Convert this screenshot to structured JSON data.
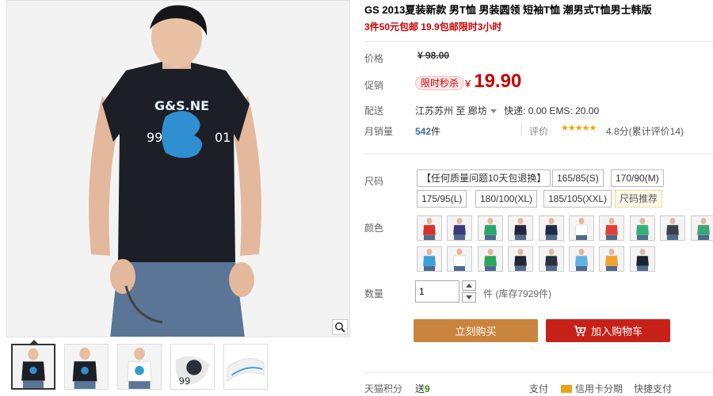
{
  "product": {
    "title": "GS 2013夏装新款 男T恤 男装圆领 短袖T恤 潮男式T恤男士韩版",
    "subtitle": "3件50元包邮 19.9包邮限时3小时"
  },
  "price": {
    "label": "价格",
    "original": "¥ 98.00"
  },
  "promo": {
    "label": "促销",
    "tag": "限时秒杀",
    "currency": "¥",
    "value": "19.90"
  },
  "shipping": {
    "label": "配送",
    "from": "江苏苏州",
    "to_word": "至",
    "dest": "廊坊",
    "fees": "快递: 0.00 EMS: 20.00"
  },
  "sales": {
    "label": "月销量",
    "count": "542",
    "unit": "件",
    "rating_label": "评价",
    "stars": "★★★★★",
    "rating_text": "4.8分(累计评价14)"
  },
  "sizes": {
    "label": "尺码",
    "options": [
      "【任何质量问题10天包退换】",
      "165/85(S)",
      "170/90(M)",
      "175/95(L)",
      "180/100(XL)",
      "185/105(XXL)"
    ],
    "hint": "尺码推荐"
  },
  "colors": {
    "label": "颜色",
    "shirt_colors": [
      "#d9302c",
      "#3a3a7a",
      "#2aa66b",
      "#22253a",
      "#1d2a48",
      "#ffffff",
      "#e0403c",
      "#33b07a",
      "#3a3f4a",
      "#3ea47a",
      "#3aa0d8",
      "#ffffff",
      "#2ba55a",
      "#222533",
      "#2a2f40",
      "#5bb3e0",
      "#f0a22a",
      "#1a2233"
    ]
  },
  "quantity": {
    "label": "数量",
    "value": "1",
    "stock": "件 (库存7929件)"
  },
  "actions": {
    "buy": "立刻购买",
    "cart": "加入购物车"
  },
  "points": {
    "label": "天猫积分",
    "prefix": "送",
    "value": "9"
  },
  "payment": {
    "methods": [
      "支付",
      "信用卡分期",
      "快捷支付"
    ]
  },
  "colors_theme": {
    "accent_red": "#c00000",
    "buy_button": "#c9833c",
    "cart_button": "#c7221a",
    "star": "#f0a500"
  }
}
